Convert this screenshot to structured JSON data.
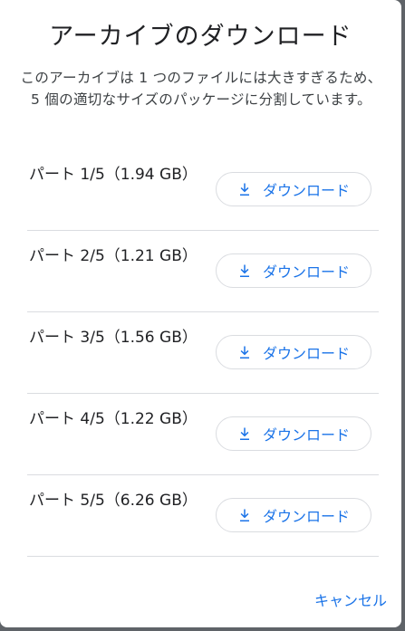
{
  "dialog": {
    "title": "アーカイブのダウンロード",
    "description": "このアーカイブは 1 つのファイルには大きすぎるため、5 個の適切なサイズのパッケージに分割しています。",
    "parts": [
      {
        "label": "パート 1/5（1.94 GB）",
        "button_label": "ダウンロード"
      },
      {
        "label": "パート 2/5（1.21 GB）",
        "button_label": "ダウンロード"
      },
      {
        "label": "パート 3/5（1.56 GB）",
        "button_label": "ダウンロード"
      },
      {
        "label": "パート 4/5（1.22 GB）",
        "button_label": "ダウンロード"
      },
      {
        "label": "パート 5/5（6.26 GB）",
        "button_label": "ダウンロード"
      }
    ],
    "cancel_label": "キャンセル"
  },
  "icons": {
    "download": "download-icon"
  },
  "colors": {
    "accent": "#1a73e8",
    "text": "#202124",
    "divider": "#dadce0",
    "backdrop": "#5f6368"
  }
}
